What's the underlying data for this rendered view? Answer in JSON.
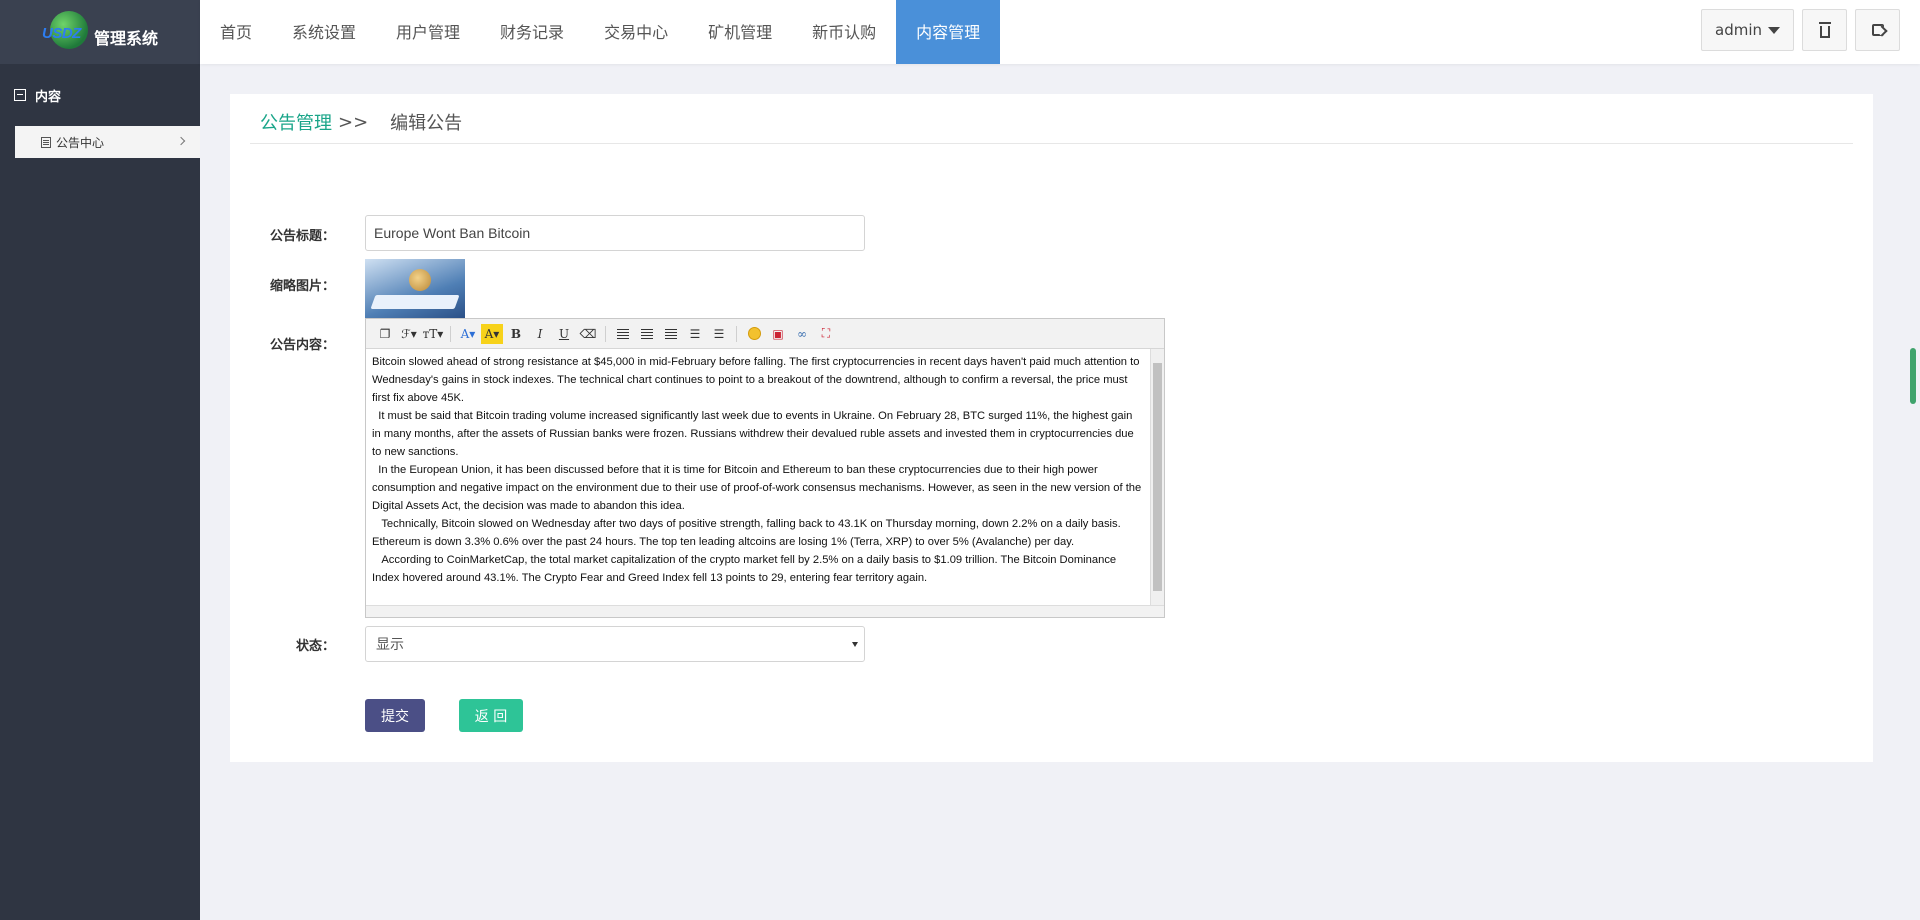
{
  "logo": {
    "brand": "USDZ",
    "title": "管理系统"
  },
  "sidebar": {
    "section": "内容",
    "items": [
      {
        "label": "公告中心"
      }
    ]
  },
  "nav": {
    "items": [
      "首页",
      "系统设置",
      "用户管理",
      "财务记录",
      "交易中心",
      "矿机管理",
      "新币认购",
      "内容管理"
    ],
    "active": "内容管理"
  },
  "topright": {
    "user": "admin"
  },
  "breadcrumb": {
    "parent": "公告管理",
    "sep": ">>",
    "current": "编辑公告"
  },
  "form": {
    "title_label": "公告标题：",
    "title_value": "Europe Wont Ban Bitcoin",
    "thumb_label": "缩略图片：",
    "content_label": "公告内容：",
    "content": [
      "Bitcoin slowed ahead of strong resistance at $45,000 in mid-February before falling. The first cryptocurrencies in recent days haven't paid much attention to Wednesday's gains in stock indexes. The technical chart continues to point to a breakout of the downtrend, although to confirm a reversal, the price must first fix above 45K.",
      "  It must be said that Bitcoin trading volume increased significantly last week due to events in Ukraine. On February 28, BTC surged 11%, the highest gain in many months, after the assets of Russian banks were frozen. Russians withdrew their devalued ruble assets and invested them in cryptocurrencies due to new sanctions.",
      "  In the European Union, it has been discussed before that it is time for Bitcoin and Ethereum to ban these cryptocurrencies due to their high power consumption and negative impact on the environment due to their use of proof-of-work consensus mechanisms. However, as seen in the new version of the Digital Assets Act, the decision was made to abandon this idea.",
      "   Technically, Bitcoin slowed on Wednesday after two days of positive strength, falling back to 43.1K on Thursday morning, down 2.2% on a daily basis. Ethereum is down 3.3% 0.6% over the past 24 hours. The top ten leading altcoins are losing 1% (Terra, XRP) to over 5% (Avalanche) per day.",
      "   According to CoinMarketCap, the total market capitalization of the crypto market fell by 2.5% on a daily basis to $1.09 trillion. The Bitcoin Dominance Index hovered around 43.1%. The Crypto Fear and Greed Index fell 13 points to 29, entering fear territory again."
    ],
    "status_label": "状态：",
    "status_value": "显示",
    "submit": "提交",
    "back": "返 回"
  },
  "colors": {
    "sidebar": "#2f3542",
    "active_nav": "#4a90d9",
    "link": "#1aa589",
    "submit": "#4b4f86",
    "back": "#2ec497"
  }
}
